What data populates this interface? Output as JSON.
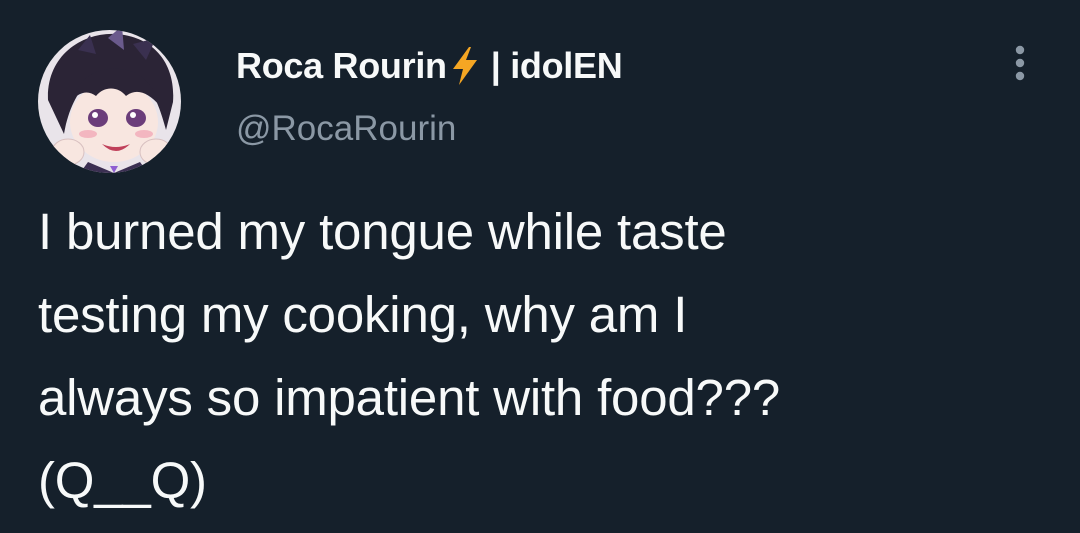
{
  "tweet": {
    "author": {
      "display_name": "Roca Rourin",
      "name_badge_icon": "lightning-bolt-icon",
      "name_suffix": "| idolEN",
      "handle": "@RocaRourin",
      "avatar_icon": "anime-avatar"
    },
    "more_icon": "more-vertical-icon",
    "text": "I burned my tongue while taste\ntesting my cooking, why am I\nalways so impatient with food???\n(Q__Q)"
  },
  "theme": {
    "background": "#15202b",
    "text_primary": "#f7f9f9",
    "text_secondary": "#8b98a5",
    "bolt_color": "#f5a623"
  }
}
